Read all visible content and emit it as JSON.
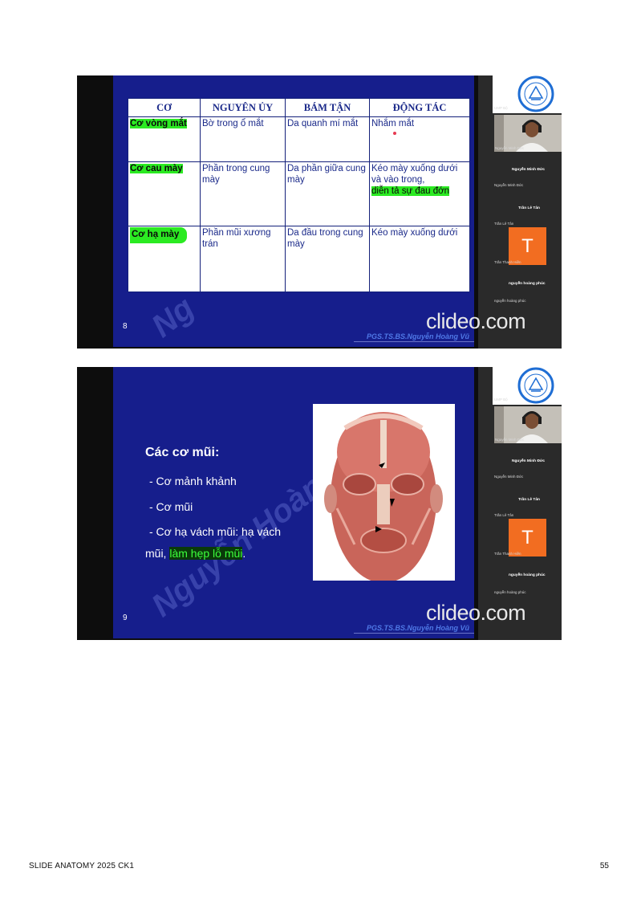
{
  "slide1": {
    "headers": [
      "CƠ",
      "NGUYÊN ỦY",
      "BÁM TẬN",
      "ĐỘNG TÁC"
    ],
    "rows": [
      [
        "Cơ vòng mắt",
        "Bờ trong ổ mắt",
        "Da quanh mí mắt",
        "Nhắm mắt"
      ],
      [
        "Cơ cau mày",
        "Phần trong cung mày",
        "Da phần giữa cung mày",
        "Kéo mày xuống dưới và vào trong,"
      ],
      [
        "Cơ hạ mày",
        "Phần mũi xương trán",
        "Da đầu trong cung mày",
        "Kéo mày xuống dưới"
      ]
    ],
    "row2_highlight": "diễn tả sự đau đớn",
    "number": "8",
    "author": "PGS.TS.BS.Nguyễn Hoàng Vũ",
    "watermark": "Ng"
  },
  "slide2": {
    "title": "Các cơ mũi:",
    "bullets": [
      "- Cơ mảnh khảnh",
      "- Cơ mũi",
      "- Cơ hạ vách mũi: hạ vách"
    ],
    "continuation_prefix": "mũi, ",
    "continuation_highlight": "làm hẹp lỗ mũi",
    "continuation_suffix": ".",
    "number": "9",
    "author": "PGS.TS.BS.Nguyễn Hoàng Vũ",
    "watermark": "Nguyễn Hoàng"
  },
  "watermark_brand": "clideo.com",
  "participants": {
    "host_label": "UMP Bộ",
    "camera_caption": "Nguyễn Minh Đức",
    "name1": "Nguyễn Minh Đức",
    "name1_sub": "Nguyễn Minh Đức",
    "name2": "Trần Lê Tân",
    "name2_sub": "Trần Lê Tân",
    "avatar_letter": "T",
    "avatar_caption": "Trần Thanh Hiền",
    "name3": "nguyễn hoàng phúc",
    "name3_sub": "nguyễn hoàng phúc"
  },
  "footer": {
    "left": "SLIDE ANATOMY 2025 CK1",
    "page": "55"
  },
  "colors": {
    "slide_bg": "#161e8c",
    "highlight": "#2bea22",
    "avatar": "#f26d21"
  }
}
